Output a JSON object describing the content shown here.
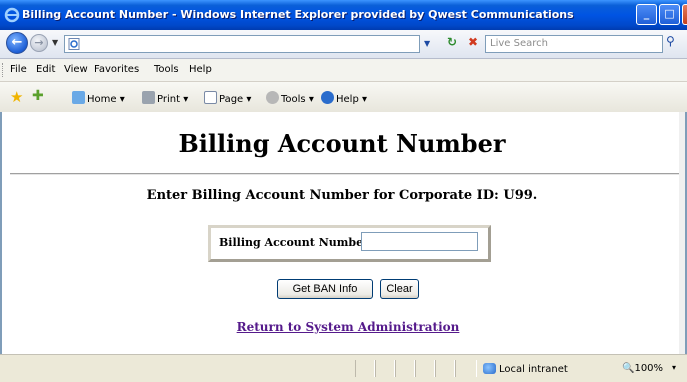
{
  "window": {
    "title": "Billing Account Number - Windows Internet Explorer provided by Qwest Communications",
    "minimize_glyph": "_",
    "maximize_glyph": "□",
    "close_glyph": "×"
  },
  "address_bar": {
    "value": "",
    "search_placeholder": "Live Search"
  },
  "menu": {
    "items": [
      "File",
      "Edit",
      "View",
      "Favorites",
      "Tools",
      "Help"
    ]
  },
  "command_bar": {
    "home_label": "Home",
    "print_label": "Print",
    "page_label": "Page",
    "tools_label": "Tools",
    "help_label": "Help"
  },
  "page": {
    "heading": "Billing Account Number",
    "instruction": "Enter Billing Account Number for Corporate ID: U99.",
    "ban_label": "Billing Account Number:",
    "ban_value": "",
    "get_button": "Get BAN Info",
    "clear_button": "Clear",
    "return_link": "Return to System Administration"
  },
  "status_bar": {
    "zone": "Local intranet",
    "zoom": "100%"
  },
  "colors": {
    "titlebar": "#0054e3",
    "link_visited": "#551a8b"
  },
  "icons": {
    "ie_logo": "ie-logo-icon",
    "back": "back-arrow-icon",
    "forward": "forward-arrow-icon",
    "refresh": "refresh-icon",
    "stop": "stop-icon",
    "search": "search-icon",
    "favorites": "favorites-star-icon",
    "add_favorites": "add-favorites-icon",
    "home": "home-icon",
    "print": "print-icon",
    "page": "page-icon",
    "tools": "tools-gear-icon",
    "help": "help-icon",
    "zone": "intranet-globe-icon"
  }
}
